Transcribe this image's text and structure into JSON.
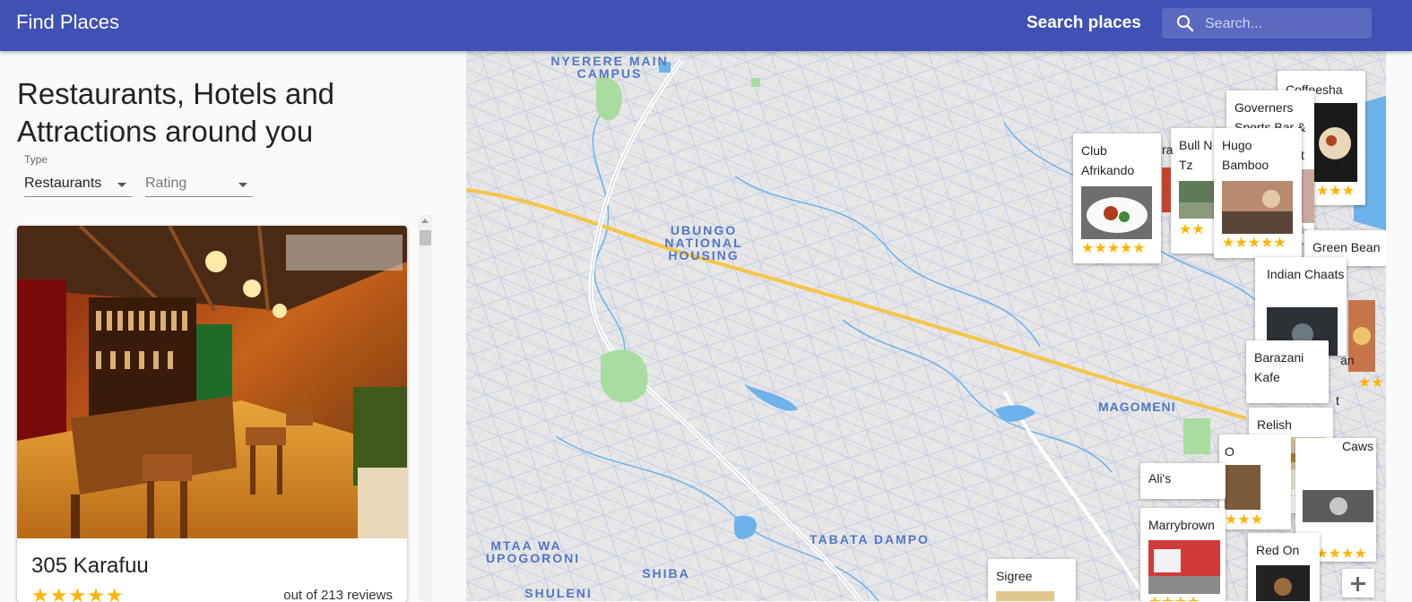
{
  "app": {
    "title": "Find Places"
  },
  "search": {
    "label": "Search places",
    "placeholder": "Search..."
  },
  "sidebar": {
    "heading": "Restaurants, Hotels and Attractions around you",
    "type": {
      "label": "Type",
      "value": "Restaurants"
    },
    "rating": {
      "value": "Rating"
    }
  },
  "card": {
    "name": "305 Karafuu",
    "stars": "★★★★★",
    "reviews": "out of 213 reviews"
  },
  "map": {
    "labels": {
      "nyerere": "NYERERE MAIN CAMPUS",
      "ubungo": "UBUNGO NATIONAL HOUSING",
      "magomeni": "MAGOMENI",
      "tabata": "TABATA DAMPO",
      "mtaa": "MTAA WA UPOGORONI",
      "shiba": "SHIBA",
      "shuleni": "SHULENI"
    },
    "pins": {
      "coffeesha": {
        "name": "Coffeesha",
        "stars": "★★★"
      },
      "governers": {
        "name": "Governers Sports Bar &",
        "fragment": "t",
        "stars": "★"
      },
      "bulln": {
        "name": "Bull N Tz",
        "stars": "★★"
      },
      "hugo": {
        "name": "Hugo Bamboo",
        "stars": "★★★★★"
      },
      "club": {
        "name": "Club Afrikando",
        "stars": "★★★★★"
      },
      "clubfrag": {
        "text": "ra"
      },
      "greenbean": {
        "name": "Green Bean"
      },
      "indian": {
        "name": "Indian Chaats",
        "stars": "★★"
      },
      "barazani": {
        "name": "Barazani Kafe",
        "frag1": "an",
        "frag2": "t",
        "stars": "★★"
      },
      "relish": {
        "name": "Relish",
        "stars": "★★★★",
        "stars_empty": "★"
      },
      "caws": {
        "name": "Caws",
        "stars": "★★★★★"
      },
      "alis": {
        "name": "Ali's"
      },
      "o": {
        "name": "O",
        "stars": "★★★"
      },
      "marrybrown": {
        "name": "Marrybrown",
        "stars": "★★★★"
      },
      "redon": {
        "name": "Red On"
      },
      "sigree": {
        "name": "Sigree"
      }
    },
    "zoom_in": "+"
  }
}
